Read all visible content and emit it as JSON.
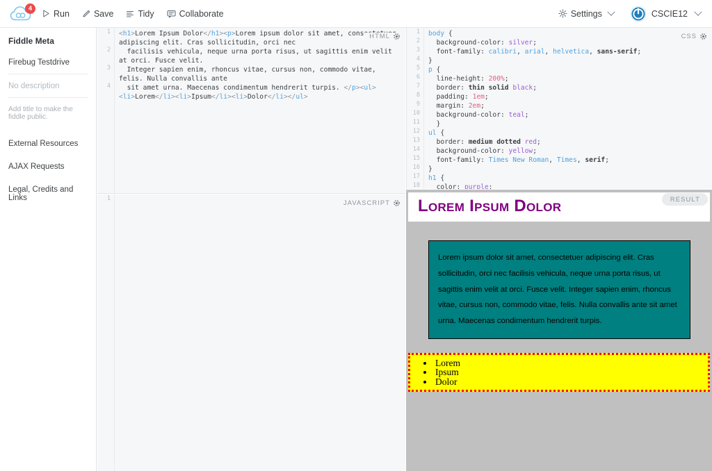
{
  "topbar": {
    "logo_name": "jsfiddle-cloud-logo",
    "notification_count": "4",
    "buttons": [
      {
        "label": "Run",
        "icon": "play-icon"
      },
      {
        "label": "Save",
        "icon": "pencil-icon"
      },
      {
        "label": "Tidy",
        "icon": "lines-icon"
      },
      {
        "label": "Collaborate",
        "icon": "chat-icon"
      }
    ],
    "settings_label": "Settings",
    "user_label": "CSCIE12"
  },
  "sidebar": {
    "title": "Fiddle Meta",
    "fiddle_title_value": "Firebug Testdrive",
    "description_placeholder": "No description",
    "public_hint": "Add title to make the fiddle public.",
    "links": [
      "External Resources",
      "AJAX Requests",
      "Legal, Credits and Links"
    ]
  },
  "panels": {
    "html": {
      "label": "HTML",
      "line_numbers": [
        "1",
        "2",
        "3",
        "4"
      ],
      "lines": [
        "<h1>Lorem Ipsum Dolor</h1><p>Lorem ipsum dolor sit amet, consectetuer adipiscing elit. Cras sollicitudin, orci nec",
        "  facilisis vehicula, neque urna porta risus, ut sagittis enim velit at orci. Fusce velit.",
        "  Integer sapien enim, rhoncus vitae, cursus non, commodo vitae, felis. Nulla convallis ante",
        "  sit amet urna. Maecenas condimentum hendrerit turpis. </p><ul><li>Lorem</li><li>Ipsum</li><li>Dolor</li></ul>"
      ]
    },
    "css": {
      "label": "CSS",
      "line_numbers": [
        "1",
        "2",
        "3",
        "4",
        "5",
        "6",
        "7",
        "8",
        "9",
        "10",
        "11",
        "12",
        "13",
        "14",
        "15",
        "16",
        "17",
        "18"
      ],
      "lines": [
        "body {",
        "  background-color: silver;",
        "  font-family: calibri, arial, helvetica, sans-serif;",
        "}",
        "p {",
        "  line-height: 200%;",
        "  border: thin solid black;",
        "  padding: 1em;",
        "  margin: 2em;",
        "  background-color: teal;",
        "  }",
        "ul {",
        "  border: medium dotted red;",
        "  background-color: yellow;",
        "  font-family: Times New Roman, Times, serif;",
        "}",
        "h1 {",
        "  color: purple;"
      ]
    },
    "javascript": {
      "label": "JAVASCRIPT",
      "line_numbers": [
        "1"
      ],
      "lines": [
        ""
      ]
    }
  },
  "result": {
    "tab_label": "RESULT",
    "heading": "Lorem Ipsum Dolor",
    "paragraph": "Lorem ipsum dolor sit amet, consectetuer adipiscing elit. Cras sollicitudin, orci nec facilisis vehicula, neque urna porta risus, ut sagittis enim velit at orci. Fusce velit. Integer sapien enim, rhoncus vitae, cursus non, commodo vitae, felis. Nulla convallis ante sit amet urna. Maecenas condimentum hendrerit turpis.",
    "list_items": [
      "Lorem",
      "Ipsum",
      "Dolor"
    ]
  },
  "colors": {
    "heading_purple": "#800080",
    "paragraph_teal": "#008080",
    "list_yellow": "#ffff00",
    "list_border_red": "#ff0000",
    "page_silver": "#c0c0c0",
    "badge_red": "#ec4b4b",
    "brand_blue": "#1a7fc1"
  }
}
